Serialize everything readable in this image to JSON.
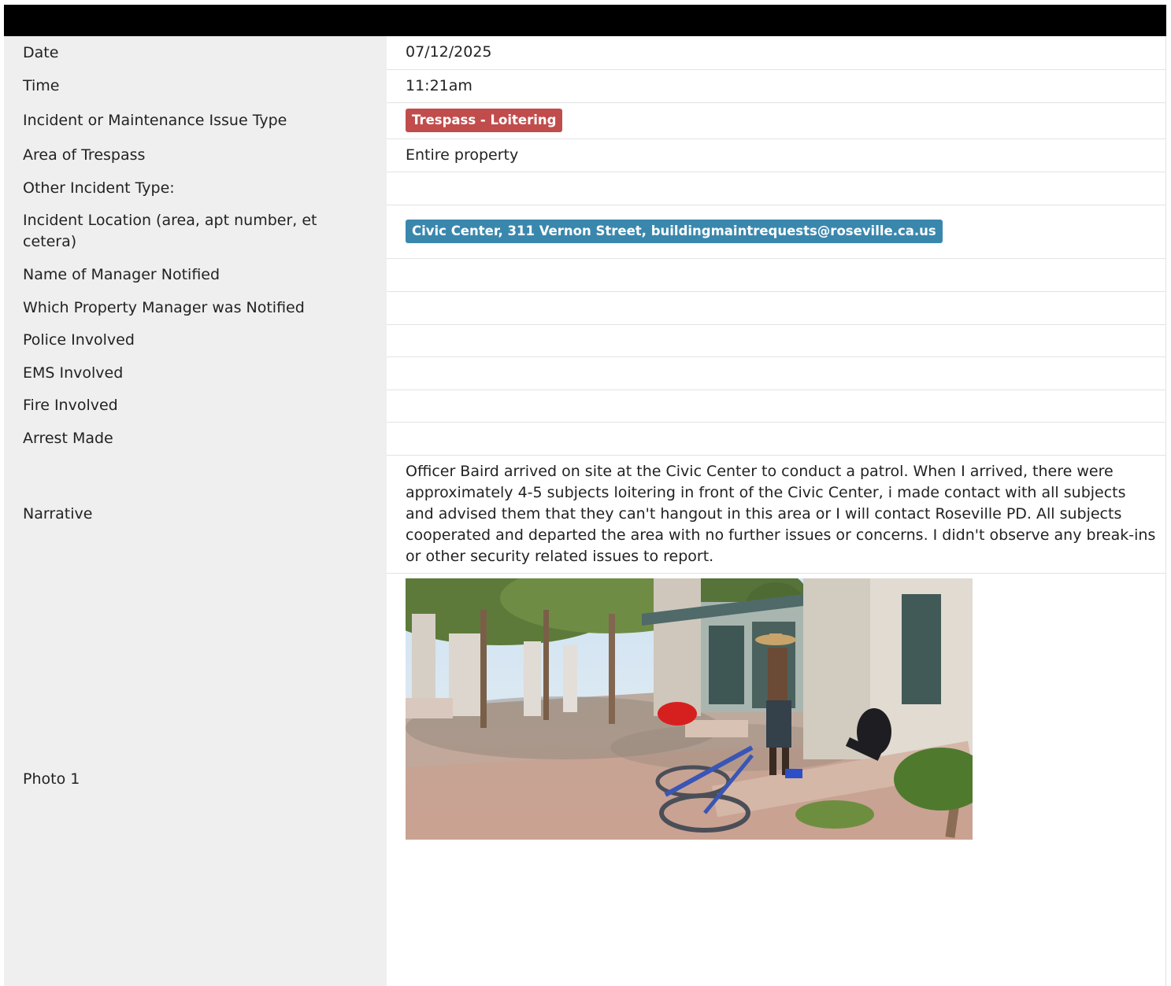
{
  "report": {
    "rows": [
      {
        "label": "Date",
        "value": "07/12/2025"
      },
      {
        "label": "Time",
        "value": "11:21am"
      },
      {
        "label": "Incident or Maintenance Issue Type",
        "value": "Trespass - Loitering"
      },
      {
        "label": "Area of Trespass",
        "value": "Entire property"
      },
      {
        "label": "Other Incident Type:",
        "value": ""
      },
      {
        "label": "Incident Location (area, apt number, et cetera)",
        "value": "Civic Center, 311 Vernon Street, buildingmaintrequests@roseville.ca.us"
      },
      {
        "label": "Name of Manager Notified",
        "value": ""
      },
      {
        "label": "Which Property Manager was Notified",
        "value": ""
      },
      {
        "label": "Police Involved",
        "value": ""
      },
      {
        "label": "EMS Involved",
        "value": ""
      },
      {
        "label": "Fire Involved",
        "value": ""
      },
      {
        "label": "Arrest Made",
        "value": ""
      },
      {
        "label": "Narrative",
        "value": "Officer Baird arrived on site at the Civic Center to conduct a patrol. When I arrived, there were approximately 4-5 subjects loitering in front of the Civic Center, i made contact with all subjects and advised them that they can't hangout in this area or I will contact Roseville PD. All subjects cooperated and departed the area with no further issues or concerns. I didn't observe any break-ins or other security related issues to report."
      },
      {
        "label": "Photo 1",
        "value": ""
      }
    ]
  },
  "colors": {
    "header_bar": "#000000",
    "label_background": "#efefef",
    "incident_type_badge": "#c14c4c",
    "location_badge": "#3a87ad"
  },
  "icons": {
    "photo": "plaza-photo-with-people-and-bicycle"
  }
}
